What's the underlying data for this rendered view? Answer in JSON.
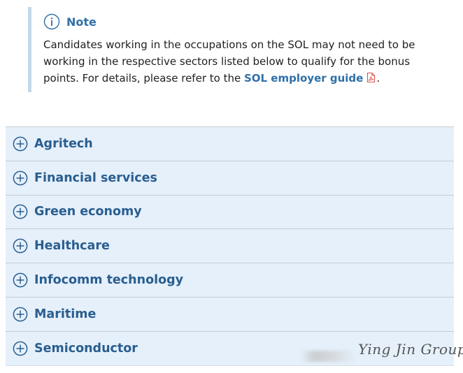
{
  "note": {
    "title": "Note",
    "icon": "info-circle-icon",
    "text_before": "Candidates working in the occupations on the SOL may not need to be working in the respective sectors listed below to qualify for the bonus points. For details, please refer to the ",
    "link_label": "SOL employer guide",
    "link_icon": "pdf-file-icon",
    "text_after": "."
  },
  "accordion": {
    "items": [
      {
        "label": "Agritech"
      },
      {
        "label": "Financial services"
      },
      {
        "label": "Green economy"
      },
      {
        "label": "Healthcare"
      },
      {
        "label": "Infocomm technology"
      },
      {
        "label": "Maritime"
      },
      {
        "label": "Semiconductor"
      }
    ]
  },
  "watermark": {
    "text": "Ying Jin Group"
  },
  "colors": {
    "accent": "#2f6fa8",
    "accordion_bg": "#e5f0fb",
    "note_border": "#c3d8ea",
    "pdf_red": "#d9534f"
  }
}
